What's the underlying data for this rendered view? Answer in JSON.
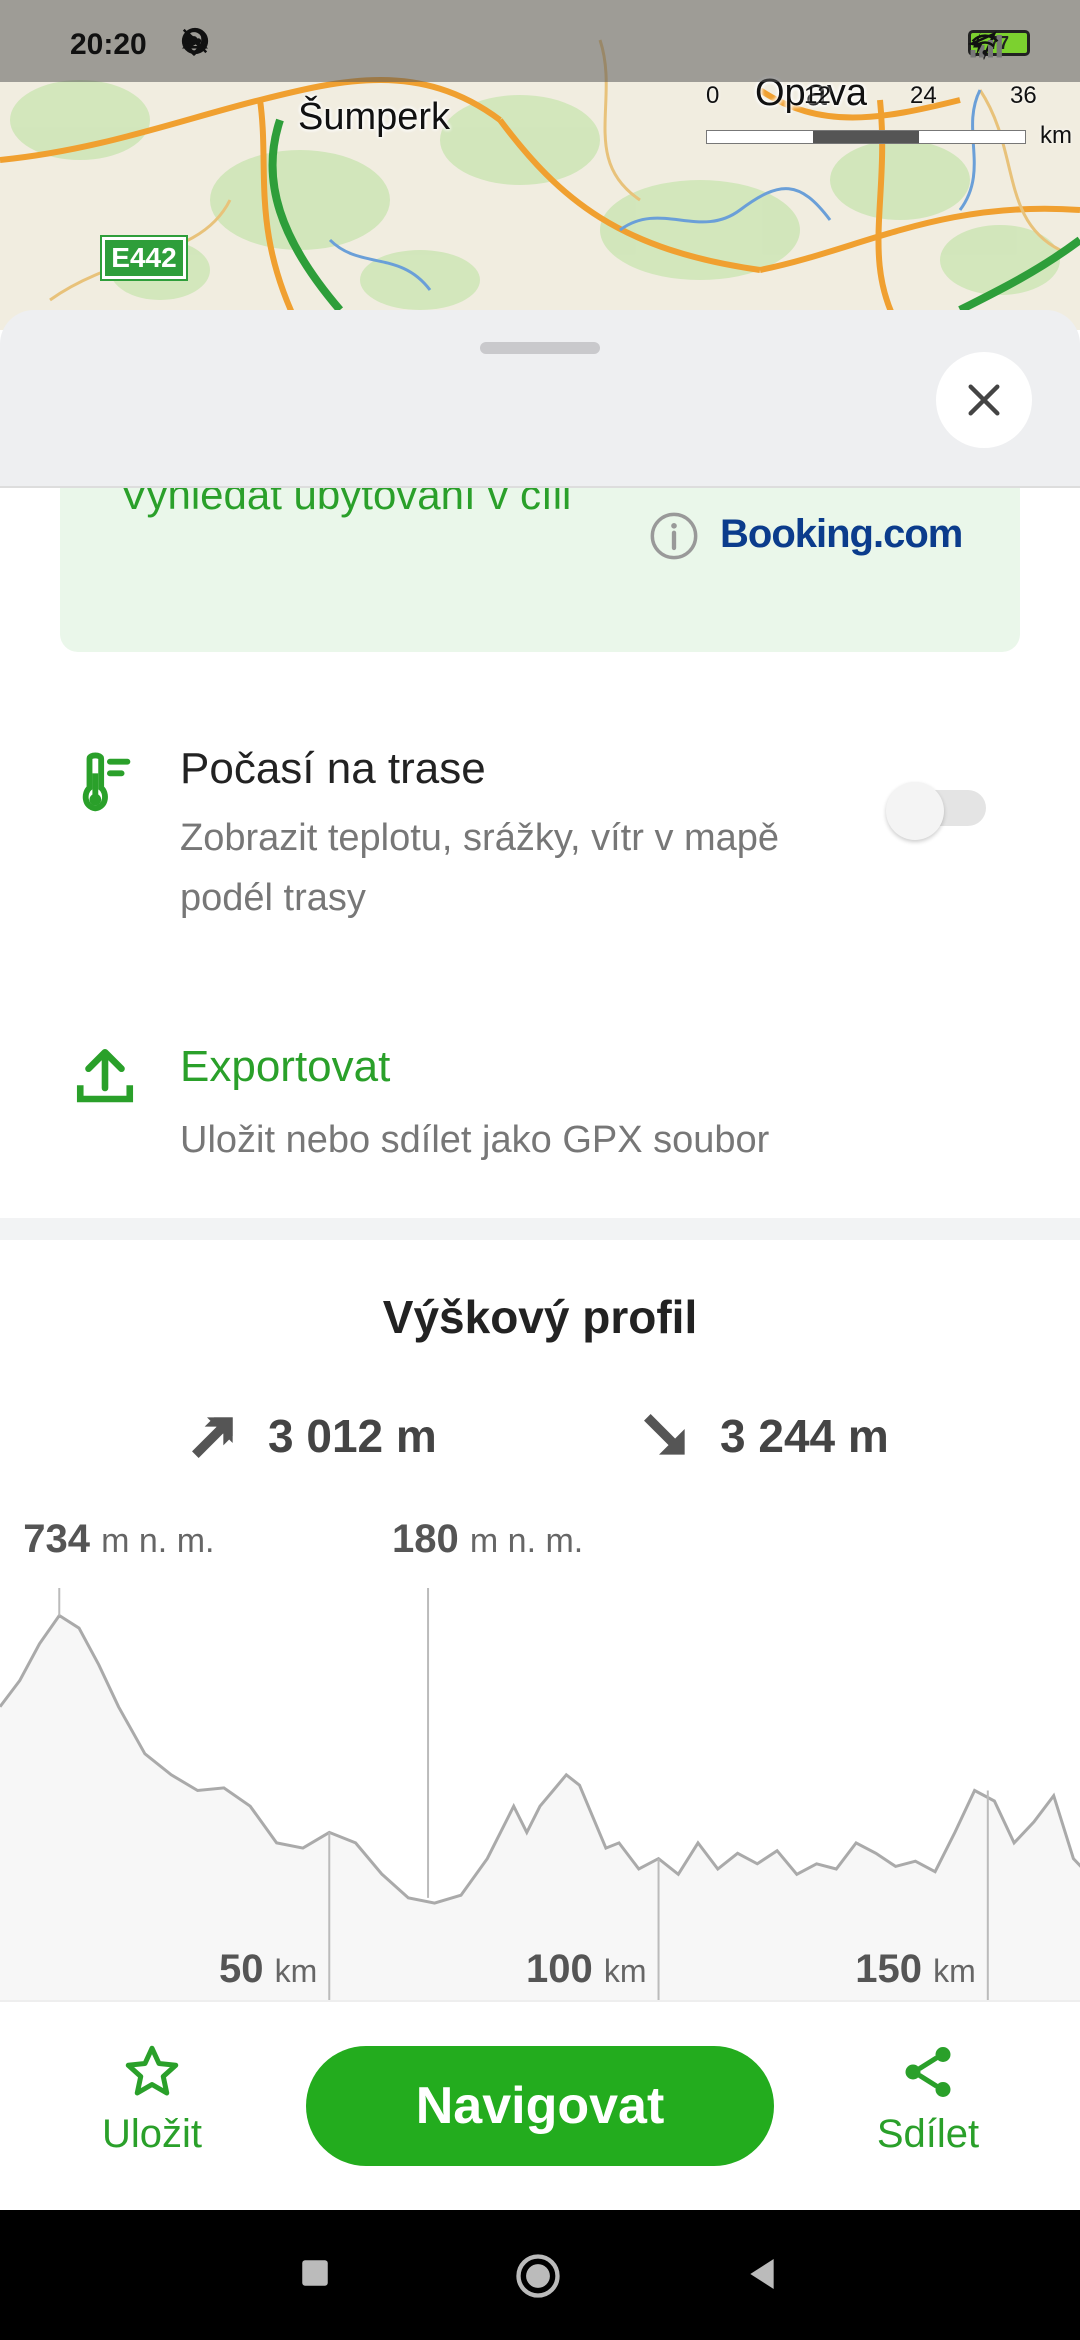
{
  "status_bar": {
    "time": "20:20",
    "battery_level": "77"
  },
  "map": {
    "cities": [
      "Šumperk",
      "Opava"
    ],
    "road_badge": "E442",
    "scale": {
      "ticks": [
        "0",
        "12",
        "24",
        "36"
      ],
      "unit": "km"
    }
  },
  "booking": {
    "text": "Vyhledat ubytování v cíli",
    "logo": "Booking.com"
  },
  "weather": {
    "title": "Počasí na trase",
    "subtitle": "Zobrazit teplotu, srážky, vítr v mapě podél trasy",
    "toggle_on": false
  },
  "export": {
    "title": "Exportovat",
    "subtitle": "Uložit nebo sdílet jako GPX soubor"
  },
  "elevation": {
    "title": "Výškový profil",
    "ascent": "3 012 m",
    "descent": "3 244 m"
  },
  "chart_data": {
    "type": "area",
    "x_unit": "km",
    "y_unit": "m n. m.",
    "annotations": [
      {
        "value": "734",
        "unit": "m n. m.",
        "x": 9
      },
      {
        "value": "180",
        "unit": "m n. m.",
        "x": 65
      }
    ],
    "x_ticks": [
      {
        "value": "50",
        "unit": "km",
        "x": 50
      },
      {
        "value": "100",
        "unit": "km",
        "x": 100
      },
      {
        "value": "150",
        "unit": "km",
        "x": 150
      }
    ],
    "x": [
      0,
      3,
      6,
      9,
      12,
      15,
      18,
      22,
      26,
      30,
      34,
      38,
      42,
      46,
      50,
      54,
      58,
      62,
      66,
      70,
      74,
      78,
      80,
      82,
      84,
      86,
      88,
      90,
      92,
      94,
      97,
      100,
      103,
      106,
      109,
      112,
      115,
      118,
      121,
      124,
      127,
      130,
      133,
      136,
      139,
      142,
      145,
      148,
      151,
      154,
      157,
      160,
      163,
      166
    ],
    "y": [
      560,
      610,
      680,
      734,
      710,
      640,
      560,
      470,
      430,
      400,
      405,
      370,
      300,
      290,
      320,
      300,
      240,
      195,
      185,
      200,
      270,
      370,
      320,
      370,
      400,
      430,
      410,
      350,
      290,
      300,
      250,
      270,
      240,
      300,
      250,
      280,
      260,
      285,
      240,
      260,
      250,
      300,
      280,
      255,
      265,
      245,
      320,
      400,
      380,
      300,
      340,
      390,
      270,
      230
    ]
  },
  "bottom_bar": {
    "save_label": "Uložit",
    "navigate_label": "Navigovat",
    "share_label": "Sdílet"
  }
}
